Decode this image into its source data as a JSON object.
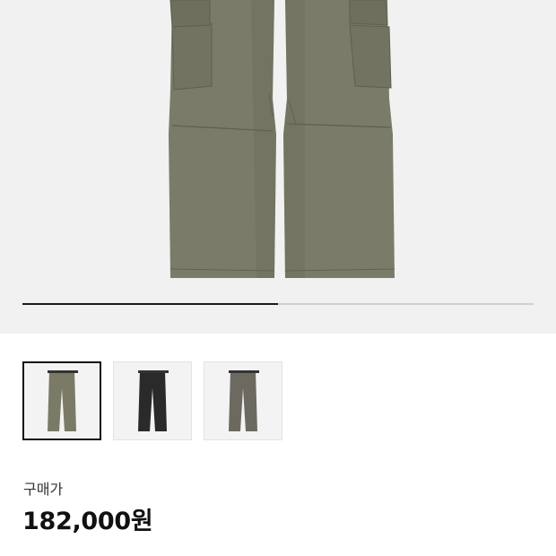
{
  "gallery": {
    "slide_progress": 0.5,
    "thumbnails": [
      {
        "name": "thumbnail-olive-pants",
        "color": "#7a7a66",
        "selected": true
      },
      {
        "name": "thumbnail-black-pants",
        "color": "#2a2a2a",
        "selected": false
      },
      {
        "name": "thumbnail-grey-pants",
        "color": "#6c6a60",
        "selected": false
      }
    ]
  },
  "price": {
    "label": "구매가",
    "value": "182,000원"
  },
  "colors": {
    "pants_main": "#7b7b69",
    "pants_shadow": "#676755",
    "hero_bg": "#f1f1f1"
  }
}
